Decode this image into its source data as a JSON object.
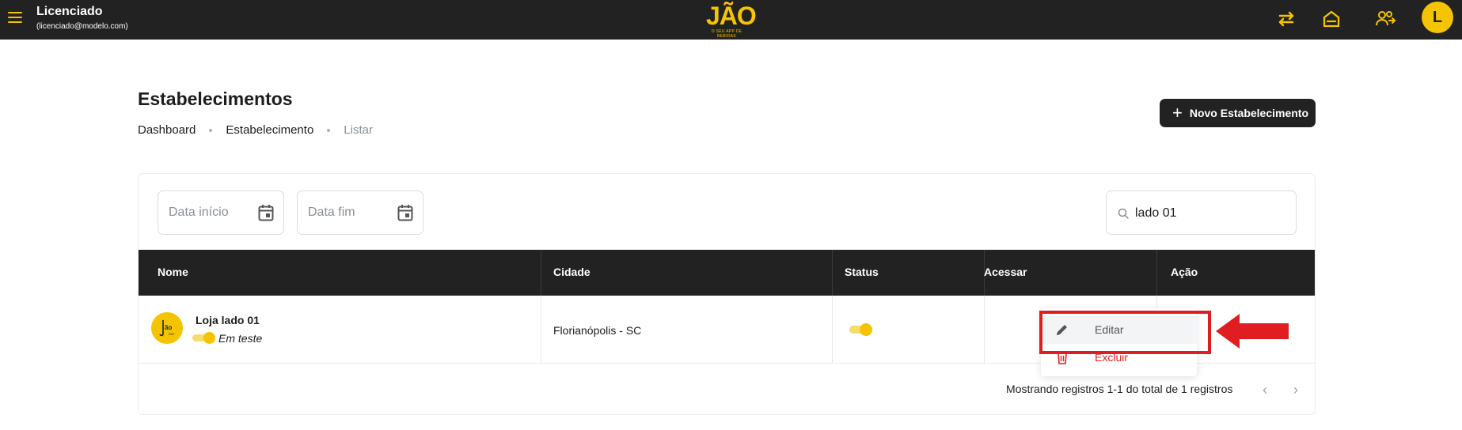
{
  "topbar": {
    "user_name": "Licenciado",
    "user_email": "(licenciado@modelo.com)",
    "logo_text": "JÃO",
    "logo_subtitle": "O SEU APP DE BEBIDAS",
    "avatar_initial": "L",
    "icons": [
      "menu-icon",
      "swap-icon",
      "home-icon",
      "users-icon"
    ],
    "accent_color": "#f5c400"
  },
  "header": {
    "title": "Estabelecimentos",
    "breadcrumb": [
      "Dashboard",
      "Estabelecimento",
      "Listar"
    ],
    "new_button_label": "Novo Estabelecimento"
  },
  "filters": {
    "start_date_placeholder": "Data início",
    "end_date_placeholder": "Data fim",
    "search_value": "lado 01"
  },
  "table": {
    "columns": [
      "Nome",
      "Cidade",
      "Status",
      "Acessar",
      "Ação"
    ],
    "rows": [
      {
        "name": "Loja lado 01",
        "mode": "Em teste",
        "city": "Florianópolis - SC",
        "status_on": true
      }
    ]
  },
  "action_menu": {
    "items": [
      "Editar",
      "Excluir"
    ],
    "danger_color": "#e31b1b"
  },
  "pagination": {
    "summary": "Mostrando registros 1-1 do total de 1 registros"
  }
}
